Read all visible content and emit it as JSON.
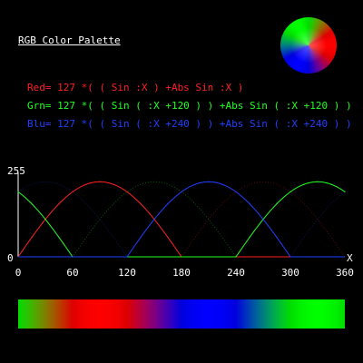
{
  "palette": {
    "title": "RGB Color Palette",
    "formulas": {
      "red": "Red= 127 *( ( Sin :X ) +Abs Sin :X )",
      "green": "Grn= 127 *( ( Sin ( :X +120 ) ) +Abs Sin ( :X +120 ) )",
      "blue": "Blu= 127 *( ( Sin ( :X +240 ) ) +Abs Sin ( :X +240 ) )"
    },
    "colors": {
      "background": "#000000",
      "text": "#ffffff",
      "red": "#ff2020",
      "green": "#20ff20",
      "blue": "#2040ff"
    }
  },
  "chart_data": {
    "type": "line",
    "title": "",
    "xlabel": "X",
    "ylabel": "",
    "xlim": [
      0,
      360
    ],
    "ylim": [
      0,
      255
    ],
    "x_ticks": [
      "0",
      "60",
      "120",
      "180",
      "240",
      "300",
      "360"
    ],
    "y_ticks": [
      "0",
      "255"
    ],
    "grid": false,
    "x": [
      0,
      15,
      30,
      45,
      60,
      75,
      90,
      105,
      120,
      135,
      150,
      165,
      180,
      195,
      210,
      225,
      240,
      255,
      270,
      285,
      300,
      315,
      330,
      345,
      360
    ],
    "series": [
      {
        "color": "#ff2020",
        "values": [
          0,
          66,
          127,
          180,
          220,
          245,
          254,
          245,
          220,
          180,
          127,
          66,
          0,
          0,
          0,
          0,
          0,
          0,
          0,
          0,
          0,
          0,
          0,
          0,
          0
        ]
      },
      {
        "color": "#20ff20",
        "values": [
          220,
          180,
          127,
          66,
          0,
          0,
          0,
          0,
          0,
          0,
          0,
          0,
          0,
          0,
          0,
          0,
          0,
          66,
          127,
          180,
          220,
          245,
          254,
          245,
          220
        ]
      },
      {
        "color": "#2040ff",
        "values": [
          0,
          0,
          0,
          0,
          0,
          0,
          0,
          0,
          0,
          66,
          127,
          180,
          220,
          245,
          254,
          245,
          220,
          180,
          127,
          66,
          0,
          0,
          0,
          0,
          0
        ]
      }
    ]
  }
}
